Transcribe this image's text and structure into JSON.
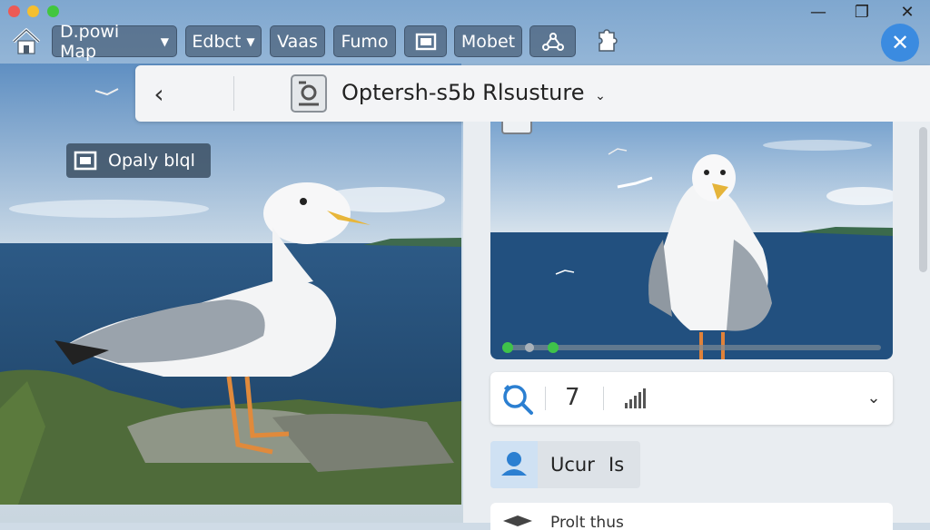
{
  "toolbar": {
    "buttons": [
      {
        "label": "D.powi Map",
        "has_caret": true
      },
      {
        "label": "Edbct",
        "has_caret": true
      },
      {
        "label": "Vaas"
      },
      {
        "label": "Fumo"
      },
      {
        "label": "Mobet"
      }
    ],
    "icons": [
      "home-icon",
      "layout-icon",
      "network-icon",
      "puzzle-icon"
    ]
  },
  "window_controls": {
    "minimize": "—",
    "maximize": "❐",
    "close": "✕"
  },
  "header": {
    "back": "‹",
    "title": "Optersh-s5b Rlsusture",
    "caret": "⌄"
  },
  "overlay_label": "Opaly blql",
  "stats": {
    "value": "7"
  },
  "user_chip": {
    "label": "Ucur",
    "suffix": "Is"
  },
  "bottom_card": {
    "text": "Prolt thus"
  },
  "colors": {
    "accent": "#3b8be0",
    "toolbar_btn": "#4a6078",
    "progress_green": "#3fc34a"
  }
}
